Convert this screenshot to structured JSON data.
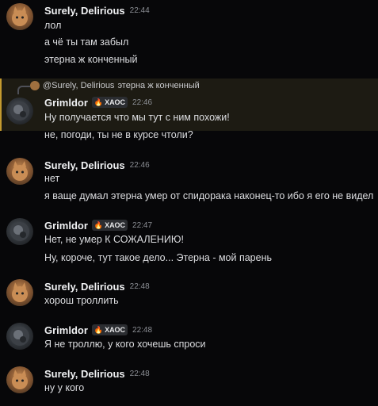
{
  "users": {
    "surely": {
      "name": "Surely, Delirious"
    },
    "grim": {
      "name": "Grimldor",
      "badge": "ХАОС"
    }
  },
  "messages": [
    {
      "author": "Surely, Delirious",
      "time": "22:44",
      "lines": [
        "лол",
        "а чё ты там забыл",
        "этерна ж конченный"
      ]
    },
    {
      "author": "Grimldor",
      "badge": "ХАОС",
      "time": "22:46",
      "reply": {
        "mention": "@Surely, Delirious",
        "text": "этерна ж конченный"
      },
      "lines": [
        "Ну получается что мы тут с ним похожи!",
        "не, погоди, ты не в курсе чтоли?"
      ]
    },
    {
      "author": "Surely, Delirious",
      "time": "22:46",
      "lines": [
        "нет",
        "я ваще думал этерна умер от спидорака наконец-то ибо я его не видел"
      ]
    },
    {
      "author": "Grimldor",
      "badge": "ХАОС",
      "time": "22:47",
      "lines": [
        "Нет, не умер К СОЖАЛЕНИЮ!",
        "Ну, короче, тут такое дело... Этерна - мой парень"
      ]
    },
    {
      "author": "Surely, Delirious",
      "time": "22:48",
      "lines": [
        "хорош троллить"
      ]
    },
    {
      "author": "Grimldor",
      "badge": "ХАОС",
      "time": "22:48",
      "lines": [
        "Я не троллю, у кого хочешь спроси"
      ]
    },
    {
      "author": "Surely, Delirious",
      "time": "22:48",
      "lines": [
        "ну у кого"
      ]
    }
  ],
  "colors": {
    "background": "#070709",
    "reply_highlight": "#1d1b13",
    "reply_bar": "#c49a2f",
    "badge_fire": "#ff4d2a"
  },
  "icons": {
    "badge": "fire-icon",
    "avatar_surely": "cat-avatar",
    "avatar_grim": "dark-avatar"
  }
}
